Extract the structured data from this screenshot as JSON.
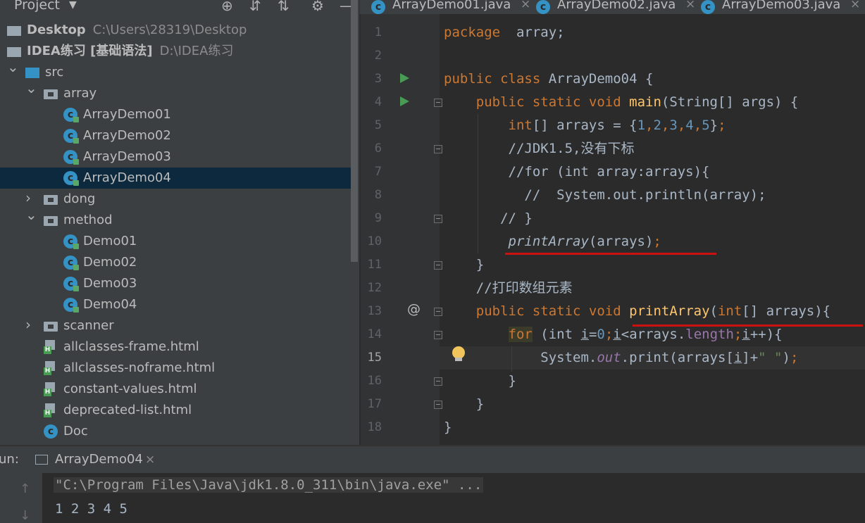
{
  "project_panel": {
    "title": "Project",
    "tools": [
      "target-icon",
      "expand-all-icon",
      "collapse-all-icon",
      "gear-icon",
      "minimize-icon"
    ],
    "tree": [
      {
        "id": "desktop",
        "label": "Desktop",
        "path": "C:\\Users\\28319\\Desktop",
        "icon": "desktop-icon",
        "indent": 0,
        "toggle": ""
      },
      {
        "id": "idea-project",
        "label": "IDEA练习 [基础语法]",
        "path": "D:\\IDEA练习",
        "icon": "module-icon",
        "indent": 0,
        "toggle": ""
      },
      {
        "id": "src",
        "label": "src",
        "path": "",
        "icon": "source-folder-icon",
        "indent": 1,
        "toggle": "open"
      },
      {
        "id": "array",
        "label": "array",
        "path": "",
        "icon": "package-icon",
        "indent": 2,
        "toggle": "open"
      },
      {
        "id": "arraydemo01",
        "label": "ArrayDemo01",
        "path": "",
        "icon": "class-icon",
        "indent": 3,
        "toggle": ""
      },
      {
        "id": "arraydemo02",
        "label": "ArrayDemo02",
        "path": "",
        "icon": "class-icon",
        "indent": 3,
        "toggle": ""
      },
      {
        "id": "arraydemo03",
        "label": "ArrayDemo03",
        "path": "",
        "icon": "class-icon",
        "indent": 3,
        "toggle": ""
      },
      {
        "id": "arraydemo04",
        "label": "ArrayDemo04",
        "path": "",
        "icon": "class-icon",
        "indent": 3,
        "toggle": "",
        "selected": true
      },
      {
        "id": "dong",
        "label": "dong",
        "path": "",
        "icon": "package-icon",
        "indent": 2,
        "toggle": "closed"
      },
      {
        "id": "method",
        "label": "method",
        "path": "",
        "icon": "package-icon",
        "indent": 2,
        "toggle": "open"
      },
      {
        "id": "demo01",
        "label": "Demo01",
        "path": "",
        "icon": "class-icon",
        "indent": 3,
        "toggle": ""
      },
      {
        "id": "demo02",
        "label": "Demo02",
        "path": "",
        "icon": "class-icon",
        "indent": 3,
        "toggle": ""
      },
      {
        "id": "demo03",
        "label": "Demo03",
        "path": "",
        "icon": "class-icon",
        "indent": 3,
        "toggle": ""
      },
      {
        "id": "demo04",
        "label": "Demo04",
        "path": "",
        "icon": "class-icon",
        "indent": 3,
        "toggle": ""
      },
      {
        "id": "scanner",
        "label": "scanner",
        "path": "",
        "icon": "package-icon",
        "indent": 2,
        "toggle": "closed"
      },
      {
        "id": "allclasses-frame",
        "label": "allclasses-frame.html",
        "path": "",
        "icon": "html-file-icon",
        "indent": 2,
        "toggle": ""
      },
      {
        "id": "allclasses-noframe",
        "label": "allclasses-noframe.html",
        "path": "",
        "icon": "html-file-icon",
        "indent": 2,
        "toggle": ""
      },
      {
        "id": "constant-values",
        "label": "constant-values.html",
        "path": "",
        "icon": "html-file-icon",
        "indent": 2,
        "toggle": ""
      },
      {
        "id": "deprecated-list",
        "label": "deprecated-list.html",
        "path": "",
        "icon": "html-file-icon",
        "indent": 2,
        "toggle": ""
      },
      {
        "id": "doc",
        "label": "Doc",
        "path": "",
        "icon": "class-icon",
        "indent": 2,
        "toggle": ""
      }
    ]
  },
  "tabs": [
    {
      "label": "ArrayDemo01.java",
      "close": "×"
    },
    {
      "label": "ArrayDemo02.java",
      "close": "×"
    },
    {
      "label": "ArrayDemo03.java",
      "close": "×"
    }
  ],
  "editor": {
    "line_numbers": [
      "1",
      "2",
      "3",
      "4",
      "5",
      "6",
      "7",
      "8",
      "9",
      "10",
      "11",
      "12",
      "13",
      "14",
      "15",
      "16",
      "17",
      "18"
    ],
    "current_line": "15",
    "lines": [
      {
        "n": "1",
        "parts": [
          [
            "kw",
            "package"
          ],
          [
            "",
            "  array;"
          ]
        ]
      },
      {
        "n": "2",
        "parts": []
      },
      {
        "n": "3",
        "parts": [
          [
            "kw",
            "public class"
          ],
          [
            "",
            " ArrayDemo04 {"
          ]
        ]
      },
      {
        "n": "4",
        "parts": [
          [
            "",
            "    "
          ],
          [
            "kw",
            "public static void"
          ],
          [
            "",
            " "
          ],
          [
            "fn",
            "main"
          ],
          [
            "",
            "(String[] args) {"
          ]
        ]
      },
      {
        "n": "5",
        "parts": [
          [
            "",
            "        "
          ],
          [
            "kw",
            "int"
          ],
          [
            "",
            "[] arrays = {"
          ],
          [
            "num",
            "1"
          ],
          [
            "kw",
            ","
          ],
          [
            "num",
            "2"
          ],
          [
            "kw",
            ","
          ],
          [
            "num",
            "3"
          ],
          [
            "kw",
            ","
          ],
          [
            "num",
            "4"
          ],
          [
            "kw",
            ","
          ],
          [
            "num",
            "5"
          ],
          [
            "",
            "}"
          ],
          [
            "kw",
            ";"
          ]
        ]
      },
      {
        "n": "6",
        "parts": [
          [
            "",
            "        "
          ],
          [
            "cm",
            "//JDK1.5,没有下标"
          ]
        ]
      },
      {
        "n": "7",
        "parts": [
          [
            "",
            "        "
          ],
          [
            "cm",
            "//for (int array:arrays){"
          ]
        ]
      },
      {
        "n": "8",
        "parts": [
          [
            "",
            "          "
          ],
          [
            "cm",
            "//  System.out.println(array);"
          ]
        ]
      },
      {
        "n": "9",
        "parts": [
          [
            "",
            "       "
          ],
          [
            "cm",
            "// }"
          ]
        ]
      },
      {
        "n": "10",
        "parts": [
          [
            "",
            "        "
          ],
          [
            "it",
            "printArray"
          ],
          [
            "",
            "(arrays)"
          ],
          [
            "kw",
            ";"
          ]
        ]
      },
      {
        "n": "11",
        "parts": [
          [
            "",
            "    }"
          ]
        ]
      },
      {
        "n": "12",
        "parts": [
          [
            "",
            "    "
          ],
          [
            "cm",
            "//打印数组元素"
          ]
        ]
      },
      {
        "n": "13",
        "parts": [
          [
            "",
            "    "
          ],
          [
            "kw",
            "public static void"
          ],
          [
            "",
            " "
          ],
          [
            "fn",
            "printArray"
          ],
          [
            "",
            "("
          ],
          [
            "kw",
            "int"
          ],
          [
            "",
            "[] arrays){"
          ]
        ]
      },
      {
        "n": "14",
        "parts": [
          [
            "",
            "        "
          ],
          [
            "forbg",
            "for"
          ],
          [
            "",
            " (int "
          ],
          [
            "und",
            "i"
          ],
          [
            "",
            "="
          ],
          [
            "num",
            "0"
          ],
          [
            "kw",
            ";"
          ],
          [
            "und",
            "i"
          ],
          [
            "",
            "<arrays."
          ],
          [
            "fld2",
            "length"
          ],
          [
            "kw",
            ";"
          ],
          [
            "und",
            "i"
          ],
          [
            "",
            "++){"
          ]
        ]
      },
      {
        "n": "15",
        "parts": [
          [
            "",
            "            System."
          ],
          [
            "fld",
            "out"
          ],
          [
            "",
            ".print(arrays["
          ],
          [
            "und",
            "i"
          ],
          [
            "",
            "]+"
          ],
          [
            "str",
            "\" \""
          ],
          [
            "",
            ")"
          ],
          [
            "kw",
            ";"
          ]
        ]
      },
      {
        "n": "16",
        "parts": [
          [
            "",
            "        }"
          ]
        ]
      },
      {
        "n": "17",
        "parts": [
          [
            "",
            "    }"
          ]
        ]
      },
      {
        "n": "18",
        "parts": [
          [
            "",
            "}"
          ]
        ]
      }
    ]
  },
  "run_panel": {
    "label": "un:",
    "tab_label": "ArrayDemo04",
    "tab_close": "×",
    "command": "\"C:\\Program Files\\Java\\jdk1.8.0_311\\bin\\java.exe\" ...",
    "output": "1 2 3 4 5"
  },
  "colors": {
    "keyword": "#cc7832",
    "number": "#6897bb",
    "function": "#ffc66d",
    "string": "#6a8759",
    "field": "#9876aa",
    "annotation_underline": "#cc1111"
  }
}
